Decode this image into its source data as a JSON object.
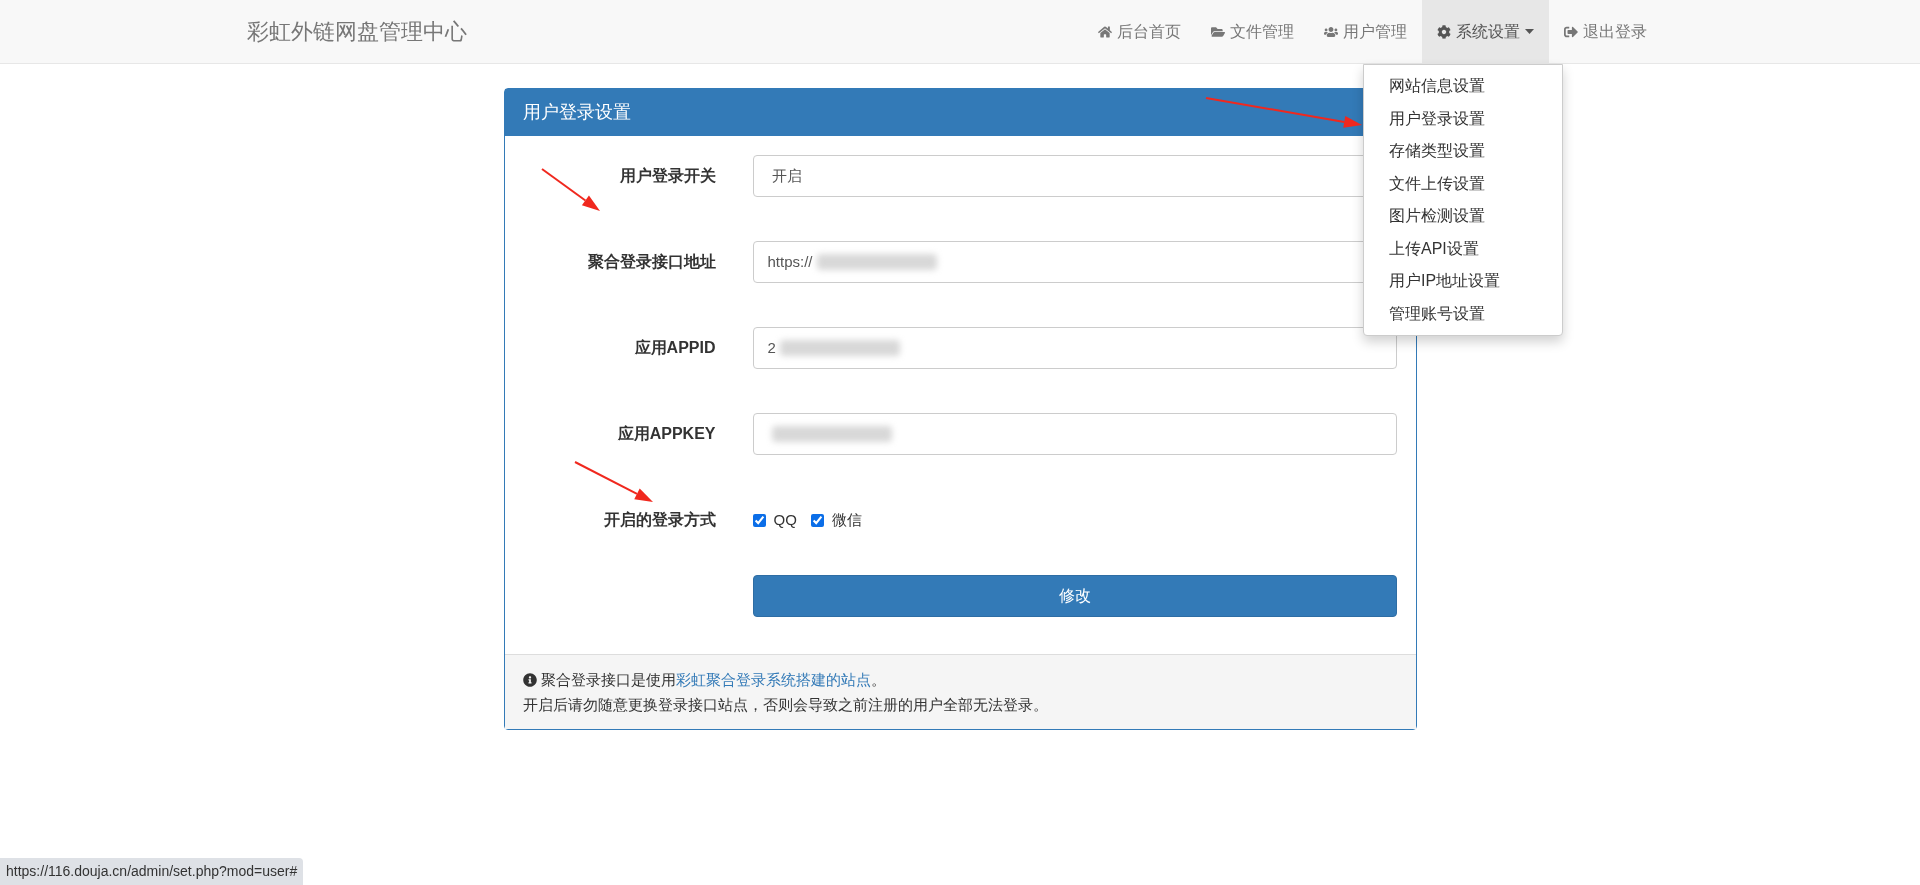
{
  "navbar": {
    "brand": "彩虹外链网盘管理中心",
    "items": [
      {
        "label": "后台首页",
        "selected": false,
        "dropdown": false
      },
      {
        "label": "文件管理",
        "selected": false,
        "dropdown": false
      },
      {
        "label": "用户管理",
        "selected": false,
        "dropdown": false
      },
      {
        "label": "系统设置",
        "selected": true,
        "dropdown": true
      },
      {
        "label": "退出登录",
        "selected": false,
        "dropdown": false
      }
    ]
  },
  "dropdown_menu": {
    "items": [
      "网站信息设置",
      "用户登录设置",
      "存储类型设置",
      "文件上传设置",
      "图片检测设置",
      "上传API设置",
      "用户IP地址设置",
      "管理账号设置"
    ]
  },
  "panel": {
    "title": "用户登录设置",
    "fields": [
      {
        "kind": "select",
        "label": "用户登录开关",
        "value": "开启"
      },
      {
        "kind": "text",
        "label": "聚合登录接口地址",
        "value": "https://",
        "redacted": true
      },
      {
        "kind": "text",
        "label": "应用APPID",
        "value": "2",
        "redacted": true
      },
      {
        "kind": "text",
        "label": "应用APPKEY",
        "redacted": true
      },
      {
        "kind": "checkboxes",
        "label": "开启的登录方式",
        "options": [
          {
            "label": "QQ",
            "checked": true
          },
          {
            "label": "微信",
            "checked": true
          }
        ]
      }
    ],
    "submit": "修改",
    "note": {
      "before": "聚合登录接口是使用",
      "link": "彩虹聚合登录系统搭建的站点",
      "after": "。",
      "line2": "开启后请勿随意更换登录接口站点，否则会导致之前注册的用户全部无法登录。"
    }
  },
  "annotations": [
    {
      "kind": "arrow"
    },
    {
      "kind": "arrow"
    },
    {
      "kind": "arrow"
    }
  ],
  "status_url": "https://116.douja.cn/admin/set.php?mod=user#"
}
